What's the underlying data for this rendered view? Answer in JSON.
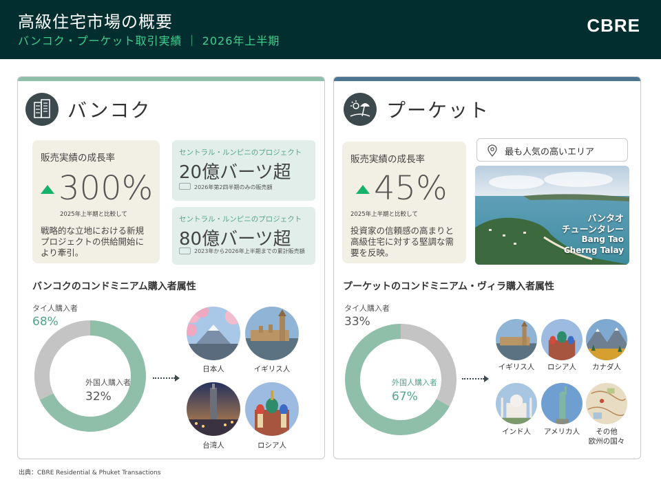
{
  "header": {
    "title": "高級住宅市場の概要",
    "subtitle": "バンコク・プーケット取引実績 ｜ 2026年上半期",
    "logo": "CBRE"
  },
  "colors": {
    "header_bg": "#032e2f",
    "accent_green": "#3ecf8e",
    "bangkok_bar": "#8fbfa8",
    "phuket_bar": "#4c7592",
    "donut_primary": "#8fbfa8",
    "donut_secondary": "#c4c4c4",
    "growth_card": "#f2efe4",
    "project_card": "#e2eeea",
    "up_arrow": "#17b26a"
  },
  "bangkok": {
    "icon": "buildings-icon",
    "name": "バンコク",
    "growth": {
      "label": "販売実績の成長率",
      "value": "300%",
      "comparison": "2025年上半期と比較して",
      "description": "戦略的な立地における新規プロジェクトの供給開始により牽引。"
    },
    "projects": [
      {
        "label": "セントラル・ルンピニのプロジェクト",
        "value": "20億バーツ超",
        "note": "2026年第2四半期のみの販売額"
      },
      {
        "label": "セントラル・ルンピニのプロジェクト",
        "value": "80億バーツ超",
        "note": "2023年から2026年上半期までの累計販売額"
      }
    ],
    "buyer_title": "バンコクのコンドミニアム購入者属性",
    "buyers": {
      "thai_label": "タイ人購入者",
      "thai_pct": "68%",
      "foreign_label": "外国人購入者",
      "foreign_pct": "32%"
    },
    "nationalities": [
      "日本人",
      "イギリス人",
      "台湾人",
      "ロシア人"
    ]
  },
  "phuket": {
    "icon": "beach-umbrella-icon",
    "name": "プーケット",
    "growth": {
      "label": "販売実績の成長率",
      "value": "45%",
      "comparison": "2025年上半期と比較して",
      "description": "投資家の信頼感の高まりと高級住宅に対する堅調な需要を反映。"
    },
    "popular": {
      "label": "最も人気の高いエリア",
      "area_jp_1": "バンタオ",
      "area_jp_2": "チューンタレー",
      "area_en_1": "Bang Tao",
      "area_en_2": "Cherng Talay"
    },
    "buyer_title": "プーケットのコンドミニアム・ヴィラ購入者属性",
    "buyers": {
      "thai_label": "タイ人購入者",
      "thai_pct": "33%",
      "foreign_label": "外国人購入者",
      "foreign_pct": "67%"
    },
    "nationalities": [
      "イギリス人",
      "ロシア人",
      "カナダ人",
      "インド人",
      "アメリカ人",
      "その他",
      "欧州の国々"
    ]
  },
  "source": "出典：CBRE Residential & Phuket Transactions",
  "chart_data": [
    {
      "type": "pie",
      "title": "バンコクのコンドミニアム購入者属性",
      "categories": [
        "タイ人購入者",
        "外国人購入者"
      ],
      "values": [
        68,
        32
      ]
    },
    {
      "type": "pie",
      "title": "プーケットのコンドミニアム・ヴィラ購入者属性",
      "categories": [
        "タイ人購入者",
        "外国人購入者"
      ],
      "values": [
        33,
        67
      ]
    }
  ]
}
